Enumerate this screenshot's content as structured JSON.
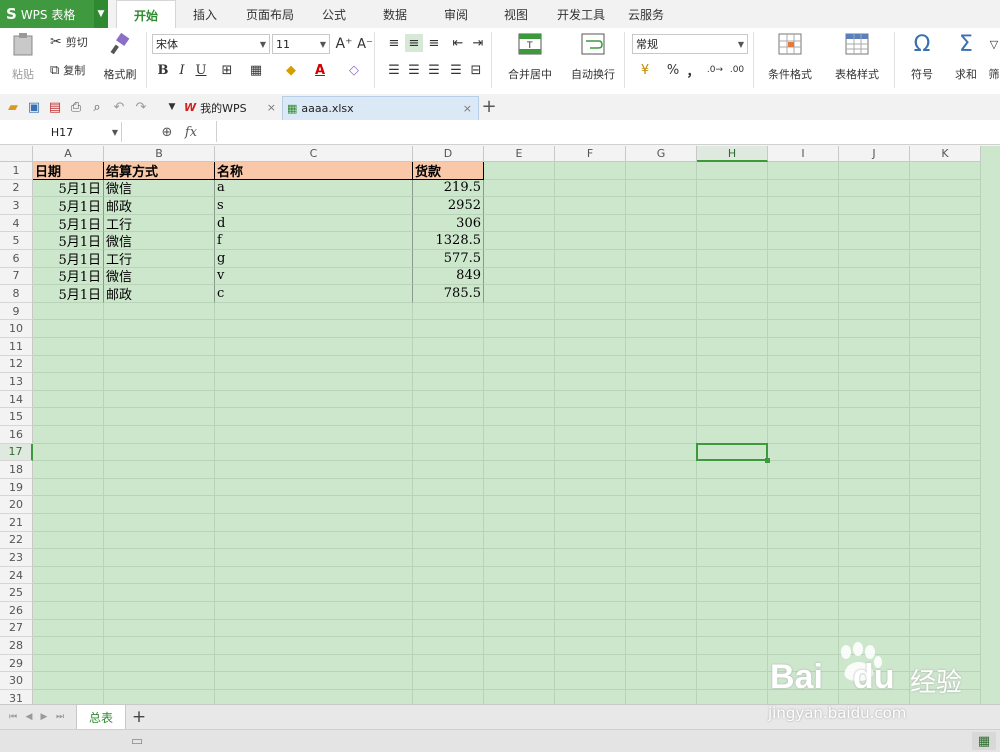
{
  "app": {
    "logo_s": "S",
    "name": "WPS 表格"
  },
  "menus": [
    "开始",
    "插入",
    "页面布局",
    "公式",
    "数据",
    "审阅",
    "视图",
    "开发工具",
    "云服务"
  ],
  "ribbon": {
    "paste": "粘贴",
    "cut": "剪切",
    "copy": "复制",
    "format_painter": "格式刷",
    "font_name": "宋体",
    "font_size": "11",
    "bold": "B",
    "italic": "I",
    "underline": "U",
    "merge_center": "合并居中",
    "wrap_text": "自动换行",
    "number_format": "常规",
    "percent": "%",
    "comma": "，",
    "conditional_format": "条件格式",
    "table_style": "表格样式",
    "symbol": "符号",
    "sum": "求和",
    "more": "筛"
  },
  "doc_tabs": [
    {
      "label": "我的WPS",
      "icon": "wps-icon"
    },
    {
      "label": "aaaa.xlsx",
      "icon": "xlsx-file-icon"
    }
  ],
  "formula_bar": {
    "name_box": "H17",
    "fx": "fx",
    "formula": ""
  },
  "columns": [
    "A",
    "B",
    "C",
    "D",
    "E",
    "F",
    "G",
    "H",
    "I",
    "J",
    "K"
  ],
  "rows": [
    "1",
    "2",
    "3",
    "4",
    "5",
    "6",
    "7",
    "8",
    "9",
    "10",
    "11",
    "12",
    "13",
    "14",
    "15",
    "16",
    "17",
    "18",
    "19",
    "20",
    "21",
    "22",
    "23",
    "24",
    "25",
    "26",
    "27",
    "28",
    "29",
    "30",
    "31"
  ],
  "table": {
    "headers": [
      "日期",
      "结算方式",
      "名称",
      "货款"
    ],
    "rows": [
      [
        "5月1日",
        "微信",
        "a",
        "219.5"
      ],
      [
        "5月1日",
        "邮政",
        "s",
        "2952"
      ],
      [
        "5月1日",
        "工行",
        "d",
        "306"
      ],
      [
        "5月1日",
        "微信",
        "f",
        "1328.5"
      ],
      [
        "5月1日",
        "工行",
        "g",
        "577.5"
      ],
      [
        "5月1日",
        "微信",
        "v",
        "849"
      ],
      [
        "5月1日",
        "邮政",
        "c",
        "785.5"
      ]
    ]
  },
  "selected_cell": "H17",
  "sheet_tabs": [
    "总表"
  ],
  "watermark": {
    "brand": "Bai",
    "brand2": "du",
    "cn": "经验",
    "url": "jingyan.baidu.com"
  },
  "colors": {
    "accent": "#3f9a3f",
    "grid_bg": "#cde7cd",
    "header_fill": "#f8c8a8"
  }
}
